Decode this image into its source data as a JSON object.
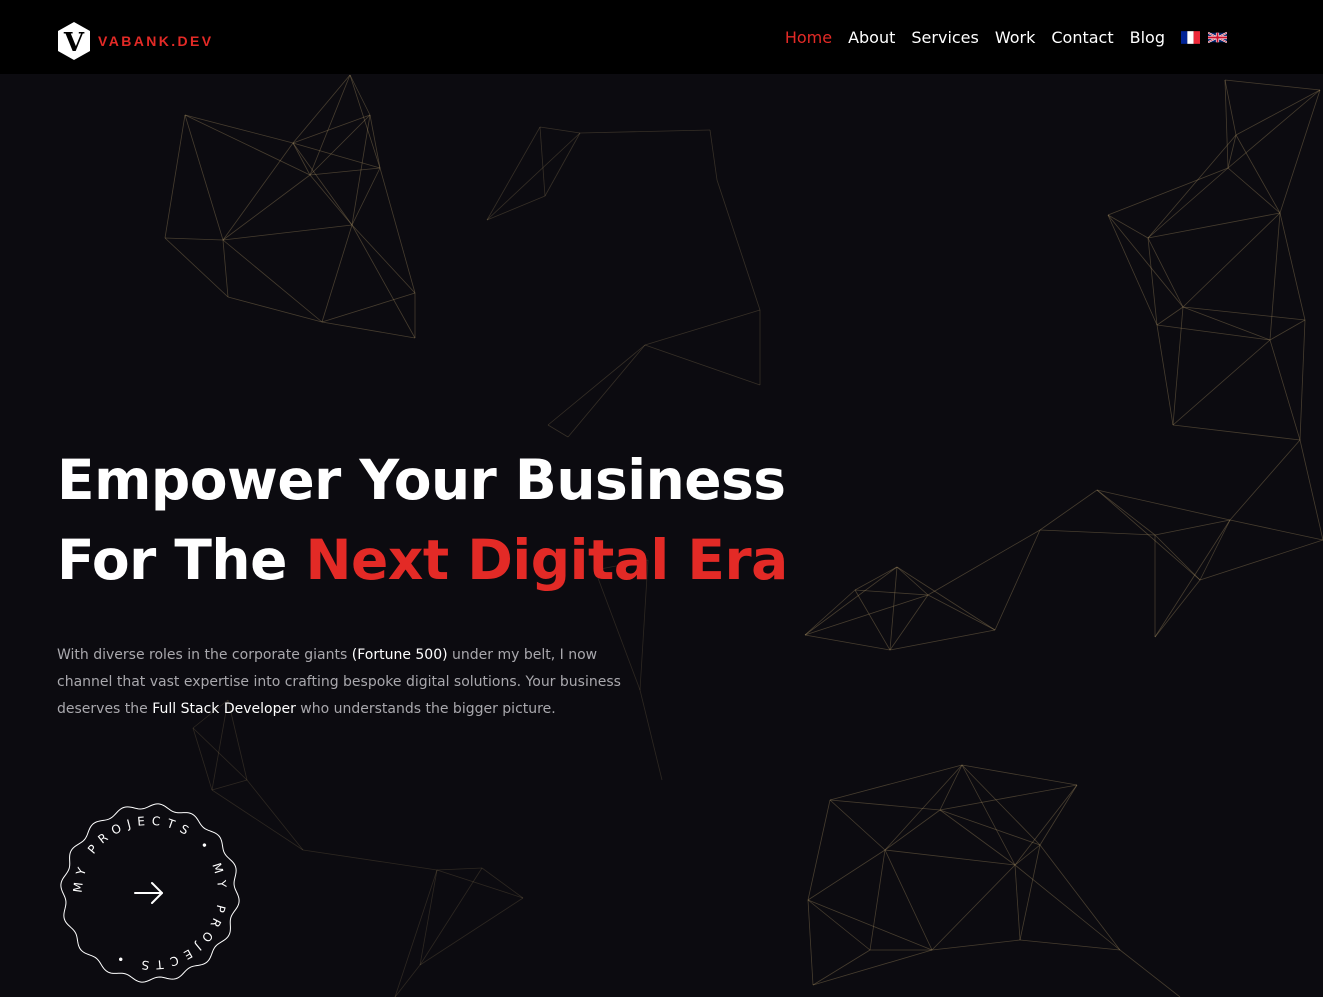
{
  "header": {
    "logo_letter": "V",
    "logo_text": "VABANK.DEV",
    "nav": [
      {
        "label": "Home",
        "active": true
      },
      {
        "label": "About",
        "active": false
      },
      {
        "label": "Services",
        "active": false
      },
      {
        "label": "Work",
        "active": false
      },
      {
        "label": "Contact",
        "active": false
      },
      {
        "label": "Blog",
        "active": false
      }
    ],
    "languages": [
      {
        "code": "fr",
        "icon": "france-flag-icon"
      },
      {
        "code": "en",
        "icon": "uk-flag-icon"
      }
    ]
  },
  "hero": {
    "line1": "Empower Your Business",
    "line2_prefix": "For The ",
    "line2_accent": "Next Digital Era"
  },
  "intro": {
    "part1": "With diverse roles in the corporate giants ",
    "highlight1": "(Fortune 500)",
    "part2": " under my belt, I now channel that vast expertise into crafting bespoke digital solutions. Your business deserves the ",
    "highlight2": "Full Stack Developer",
    "part3": " who understands the bigger picture."
  },
  "projects_badge": {
    "circular_text": "MY PROJECTS • MY PROJECTS •",
    "icon": "arrow-right-icon"
  },
  "colors": {
    "accent": "#e32a26",
    "background": "#0c0b10",
    "header_bg": "#000000",
    "text": "#ffffff",
    "muted_text": "#a9a8ad",
    "network_lines": "#b59a6a"
  }
}
